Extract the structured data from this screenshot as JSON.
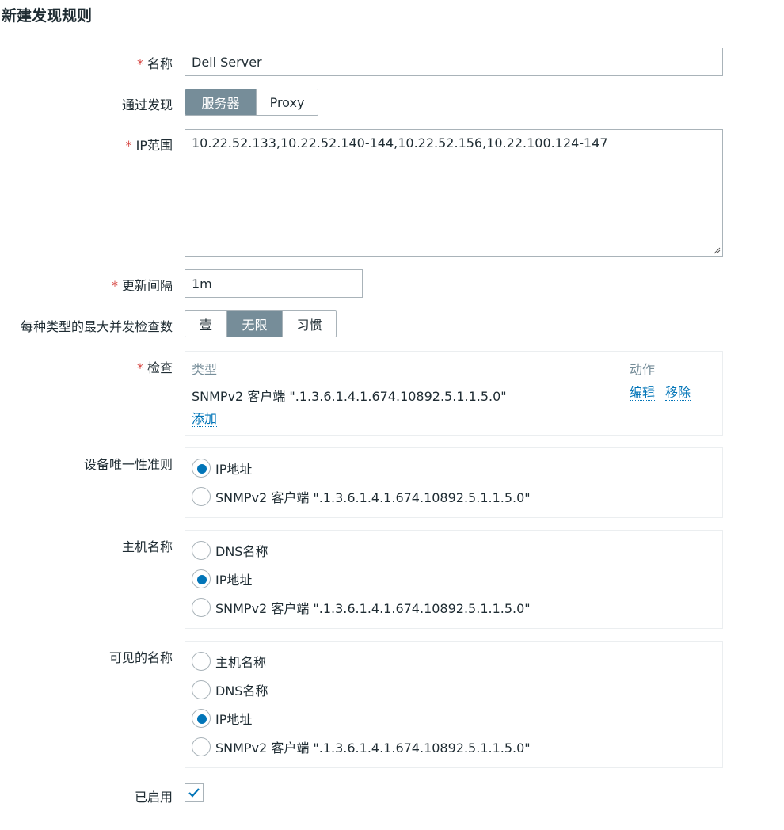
{
  "page": {
    "title": "新建发现规则"
  },
  "form": {
    "name": {
      "label": "名称",
      "required": "*",
      "value": "Dell Server"
    },
    "discovery_by": {
      "label": "通过发现",
      "options": [
        "服务器",
        "Proxy"
      ],
      "selected": "服务器"
    },
    "ip_range": {
      "label": "IP范围",
      "required": "*",
      "value": "10.22.52.133,10.22.52.140-144,10.22.52.156,10.22.100.124-147"
    },
    "update_interval": {
      "label": "更新间隔",
      "required": "*",
      "value": "1m"
    },
    "max_concurrent": {
      "label": "每种类型的最大并发检查数",
      "options": [
        "壹",
        "无限",
        "习惯"
      ],
      "selected": "无限"
    },
    "checks": {
      "label": "检查",
      "required": "*",
      "col_type": "类型",
      "col_action": "动作",
      "rows": [
        {
          "type": "SNMPv2 客户端 \".1.3.6.1.4.1.674.10892.5.1.1.5.0\"",
          "edit": "编辑",
          "remove": "移除"
        }
      ],
      "add": "添加"
    },
    "uniqueness": {
      "label": "设备唯一性准则",
      "options": [
        "IP地址",
        "SNMPv2 客户端 \".1.3.6.1.4.1.674.10892.5.1.1.5.0\""
      ],
      "selected": "IP地址"
    },
    "host_name": {
      "label": "主机名称",
      "options": [
        "DNS名称",
        "IP地址",
        "SNMPv2 客户端 \".1.3.6.1.4.1.674.10892.5.1.1.5.0\""
      ],
      "selected": "IP地址"
    },
    "visible_name": {
      "label": "可见的名称",
      "options": [
        "主机名称",
        "DNS名称",
        "IP地址",
        "SNMPv2 客户端 \".1.3.6.1.4.1.674.10892.5.1.1.5.0\""
      ],
      "selected": "IP地址"
    },
    "enabled": {
      "label": "已启用",
      "checked": true
    }
  },
  "colors": {
    "accent": "#0275b8",
    "segment_active": "#768d99",
    "required": "#d64541",
    "border": "#a9b3b9"
  },
  "icons": {
    "enabled_check": "checkmark-icon",
    "textarea_resize": "resize-grip-icon"
  }
}
